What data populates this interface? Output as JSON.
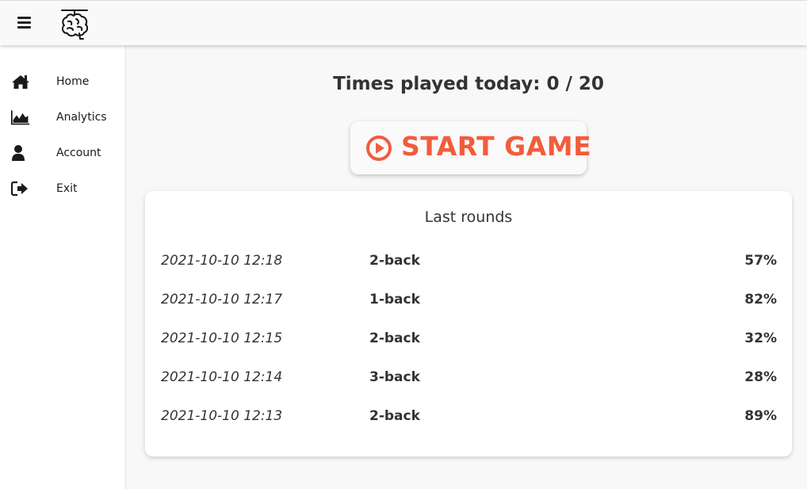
{
  "app": {
    "logo_icon": "brain-icon",
    "menu_icon": "hamburger-icon"
  },
  "sidebar": {
    "items": [
      {
        "label": "Home",
        "icon": "home-icon"
      },
      {
        "label": "Analytics",
        "icon": "area-chart-icon"
      },
      {
        "label": "Account",
        "icon": "user-icon"
      },
      {
        "label": "Exit",
        "icon": "sign-out-icon"
      }
    ]
  },
  "main": {
    "times_played": "Times played today: 0 / 20",
    "start_button": {
      "label": "START GAME",
      "icon": "play-circle-icon",
      "color": "#f25c3c"
    },
    "last_rounds": {
      "title": "Last rounds",
      "rows": [
        {
          "date": "2021-10-10 12:18",
          "level": "2-back",
          "score": "57%"
        },
        {
          "date": "2021-10-10 12:17",
          "level": "1-back",
          "score": "82%"
        },
        {
          "date": "2021-10-10 12:15",
          "level": "2-back",
          "score": "32%"
        },
        {
          "date": "2021-10-10 12:14",
          "level": "3-back",
          "score": "28%"
        },
        {
          "date": "2021-10-10 12:13",
          "level": "2-back",
          "score": "89%"
        }
      ]
    }
  }
}
